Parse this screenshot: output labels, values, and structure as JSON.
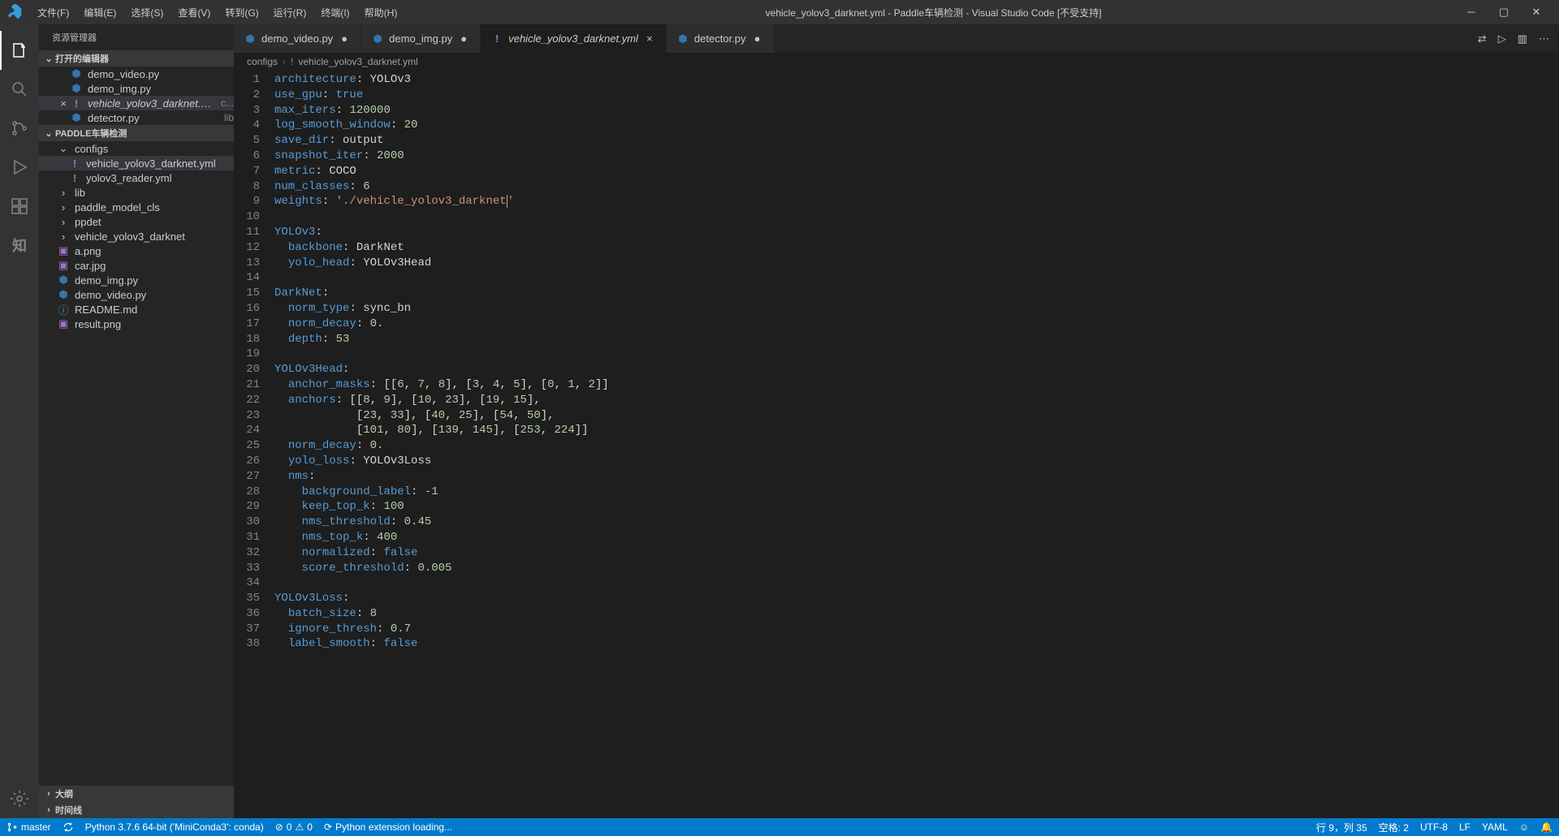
{
  "titlebar": {
    "title": "vehicle_yolov3_darknet.yml - Paddle车辆检测 - Visual Studio Code [不受支持]",
    "menu": [
      "文件(F)",
      "编辑(E)",
      "选择(S)",
      "查看(V)",
      "转到(G)",
      "运行(R)",
      "终端(I)",
      "帮助(H)"
    ]
  },
  "sidebar": {
    "title": "资源管理器",
    "sections": {
      "openEditors": "打开的编辑器",
      "project": "PADDLE车辆检测",
      "outline": "大纲",
      "timeline": "时间线"
    },
    "openEditors": [
      {
        "icon": "py",
        "label": "demo_video.py"
      },
      {
        "icon": "py",
        "label": "demo_img.py"
      },
      {
        "icon": "yml",
        "label": "vehicle_yolov3_darknet.yml",
        "hint": "c...",
        "active": true,
        "close": true,
        "italic": true
      },
      {
        "icon": "py",
        "label": "detector.py",
        "hint": "lib"
      }
    ],
    "tree": [
      {
        "type": "folder",
        "label": "configs",
        "open": true,
        "indent": 1
      },
      {
        "type": "file",
        "icon": "yml",
        "label": "vehicle_yolov3_darknet.yml",
        "indent": 2,
        "selected": true
      },
      {
        "type": "file",
        "icon": "yml",
        "label": "yolov3_reader.yml",
        "indent": 2
      },
      {
        "type": "folder",
        "label": "lib",
        "indent": 1
      },
      {
        "type": "folder",
        "label": "paddle_model_cls",
        "indent": 1
      },
      {
        "type": "folder",
        "label": "ppdet",
        "indent": 1
      },
      {
        "type": "folder",
        "label": "vehicle_yolov3_darknet",
        "indent": 1
      },
      {
        "type": "file",
        "icon": "img",
        "label": "a.png",
        "indent": 1
      },
      {
        "type": "file",
        "icon": "img",
        "label": "car.jpg",
        "indent": 1
      },
      {
        "type": "file",
        "icon": "py",
        "label": "demo_img.py",
        "indent": 1
      },
      {
        "type": "file",
        "icon": "py",
        "label": "demo_video.py",
        "indent": 1
      },
      {
        "type": "file",
        "icon": "md",
        "label": "README.md",
        "indent": 1
      },
      {
        "type": "file",
        "icon": "img",
        "label": "result.png",
        "indent": 1
      }
    ]
  },
  "tabs": [
    {
      "icon": "py",
      "label": "demo_video.py",
      "modified": true
    },
    {
      "icon": "py",
      "label": "demo_img.py",
      "modified": true
    },
    {
      "icon": "yml",
      "label": "vehicle_yolov3_darknet.yml",
      "active": true,
      "close": true,
      "italic": true,
      "modified": true
    },
    {
      "icon": "py",
      "label": "detector.py",
      "modified": true
    }
  ],
  "breadcrumb": {
    "parts": [
      "configs",
      "vehicle_yolov3_darknet.yml"
    ],
    "icon2": "yml"
  },
  "code_lines": [
    [
      {
        "t": "key",
        "v": "architecture"
      },
      {
        "t": "punc",
        "v": ":"
      },
      {
        "t": "plain",
        "v": " YOLOv3"
      }
    ],
    [
      {
        "t": "key",
        "v": "use_gpu"
      },
      {
        "t": "punc",
        "v": ":"
      },
      {
        "t": "plain",
        "v": " "
      },
      {
        "t": "bool",
        "v": "true"
      }
    ],
    [
      {
        "t": "key",
        "v": "max_iters"
      },
      {
        "t": "punc",
        "v": ":"
      },
      {
        "t": "plain",
        "v": " "
      },
      {
        "t": "num",
        "v": "120000"
      }
    ],
    [
      {
        "t": "key",
        "v": "log_smooth_window"
      },
      {
        "t": "punc",
        "v": ":"
      },
      {
        "t": "plain",
        "v": " "
      },
      {
        "t": "num",
        "v": "20"
      }
    ],
    [
      {
        "t": "key",
        "v": "save_dir"
      },
      {
        "t": "punc",
        "v": ":"
      },
      {
        "t": "plain",
        "v": " output"
      }
    ],
    [
      {
        "t": "key",
        "v": "snapshot_iter"
      },
      {
        "t": "punc",
        "v": ":"
      },
      {
        "t": "plain",
        "v": " "
      },
      {
        "t": "num",
        "v": "2000"
      }
    ],
    [
      {
        "t": "key",
        "v": "metric"
      },
      {
        "t": "punc",
        "v": ":"
      },
      {
        "t": "plain",
        "v": " COCO"
      }
    ],
    [
      {
        "t": "key",
        "v": "num_classes"
      },
      {
        "t": "punc",
        "v": ":"
      },
      {
        "t": "plain",
        "v": " "
      },
      {
        "t": "num",
        "v": "6"
      }
    ],
    [
      {
        "t": "key",
        "v": "weights"
      },
      {
        "t": "punc",
        "v": ":"
      },
      {
        "t": "plain",
        "v": " "
      },
      {
        "t": "str",
        "v": "'./vehicle_yolov3_darknet"
      },
      {
        "t": "cursor",
        "v": ""
      },
      {
        "t": "str",
        "v": "'"
      }
    ],
    [],
    [
      {
        "t": "key",
        "v": "YOLOv3"
      },
      {
        "t": "punc",
        "v": ":"
      }
    ],
    [
      {
        "t": "plain",
        "v": "  "
      },
      {
        "t": "key",
        "v": "backbone"
      },
      {
        "t": "punc",
        "v": ":"
      },
      {
        "t": "plain",
        "v": " DarkNet"
      }
    ],
    [
      {
        "t": "plain",
        "v": "  "
      },
      {
        "t": "key",
        "v": "yolo_head"
      },
      {
        "t": "punc",
        "v": ":"
      },
      {
        "t": "plain",
        "v": " YOLOv3Head"
      }
    ],
    [],
    [
      {
        "t": "key",
        "v": "DarkNet"
      },
      {
        "t": "punc",
        "v": ":"
      }
    ],
    [
      {
        "t": "plain",
        "v": "  "
      },
      {
        "t": "key",
        "v": "norm_type"
      },
      {
        "t": "punc",
        "v": ":"
      },
      {
        "t": "plain",
        "v": " sync_bn"
      }
    ],
    [
      {
        "t": "plain",
        "v": "  "
      },
      {
        "t": "key",
        "v": "norm_decay"
      },
      {
        "t": "punc",
        "v": ":"
      },
      {
        "t": "plain",
        "v": " "
      },
      {
        "t": "num",
        "v": "0."
      }
    ],
    [
      {
        "t": "plain",
        "v": "  "
      },
      {
        "t": "key",
        "v": "depth"
      },
      {
        "t": "punc",
        "v": ":"
      },
      {
        "t": "plain",
        "v": " "
      },
      {
        "t": "num",
        "v": "53"
      }
    ],
    [],
    [
      {
        "t": "key",
        "v": "YOLOv3Head"
      },
      {
        "t": "punc",
        "v": ":"
      }
    ],
    [
      {
        "t": "plain",
        "v": "  "
      },
      {
        "t": "key",
        "v": "anchor_masks"
      },
      {
        "t": "punc",
        "v": ":"
      },
      {
        "t": "plain",
        "v": " [["
      },
      {
        "t": "num",
        "v": "6"
      },
      {
        "t": "plain",
        "v": ", "
      },
      {
        "t": "num",
        "v": "7"
      },
      {
        "t": "plain",
        "v": ", "
      },
      {
        "t": "num",
        "v": "8"
      },
      {
        "t": "plain",
        "v": "], ["
      },
      {
        "t": "num",
        "v": "3"
      },
      {
        "t": "plain",
        "v": ", "
      },
      {
        "t": "num",
        "v": "4"
      },
      {
        "t": "plain",
        "v": ", "
      },
      {
        "t": "num",
        "v": "5"
      },
      {
        "t": "plain",
        "v": "], ["
      },
      {
        "t": "num",
        "v": "0"
      },
      {
        "t": "plain",
        "v": ", "
      },
      {
        "t": "num",
        "v": "1"
      },
      {
        "t": "plain",
        "v": ", "
      },
      {
        "t": "num",
        "v": "2"
      },
      {
        "t": "plain",
        "v": "]]"
      }
    ],
    [
      {
        "t": "plain",
        "v": "  "
      },
      {
        "t": "key",
        "v": "anchors"
      },
      {
        "t": "punc",
        "v": ":"
      },
      {
        "t": "plain",
        "v": " [["
      },
      {
        "t": "num",
        "v": "8"
      },
      {
        "t": "plain",
        "v": ", "
      },
      {
        "t": "num",
        "v": "9"
      },
      {
        "t": "plain",
        "v": "], ["
      },
      {
        "t": "num",
        "v": "10"
      },
      {
        "t": "plain",
        "v": ", "
      },
      {
        "t": "num",
        "v": "23"
      },
      {
        "t": "plain",
        "v": "], ["
      },
      {
        "t": "num",
        "v": "19"
      },
      {
        "t": "plain",
        "v": ", "
      },
      {
        "t": "num",
        "v": "15"
      },
      {
        "t": "plain",
        "v": "],"
      }
    ],
    [
      {
        "t": "plain",
        "v": "            ["
      },
      {
        "t": "num",
        "v": "23"
      },
      {
        "t": "plain",
        "v": ", "
      },
      {
        "t": "num",
        "v": "33"
      },
      {
        "t": "plain",
        "v": "], ["
      },
      {
        "t": "num",
        "v": "40"
      },
      {
        "t": "plain",
        "v": ", "
      },
      {
        "t": "num",
        "v": "25"
      },
      {
        "t": "plain",
        "v": "], ["
      },
      {
        "t": "num",
        "v": "54"
      },
      {
        "t": "plain",
        "v": ", "
      },
      {
        "t": "num",
        "v": "50"
      },
      {
        "t": "plain",
        "v": "],"
      }
    ],
    [
      {
        "t": "plain",
        "v": "            ["
      },
      {
        "t": "num",
        "v": "101"
      },
      {
        "t": "plain",
        "v": ", "
      },
      {
        "t": "num",
        "v": "80"
      },
      {
        "t": "plain",
        "v": "], ["
      },
      {
        "t": "num",
        "v": "139"
      },
      {
        "t": "plain",
        "v": ", "
      },
      {
        "t": "num",
        "v": "145"
      },
      {
        "t": "plain",
        "v": "], ["
      },
      {
        "t": "num",
        "v": "253"
      },
      {
        "t": "plain",
        "v": ", "
      },
      {
        "t": "num",
        "v": "224"
      },
      {
        "t": "plain",
        "v": "]]"
      }
    ],
    [
      {
        "t": "plain",
        "v": "  "
      },
      {
        "t": "key",
        "v": "norm_decay"
      },
      {
        "t": "punc",
        "v": ":"
      },
      {
        "t": "plain",
        "v": " "
      },
      {
        "t": "num",
        "v": "0."
      }
    ],
    [
      {
        "t": "plain",
        "v": "  "
      },
      {
        "t": "key",
        "v": "yolo_loss"
      },
      {
        "t": "punc",
        "v": ":"
      },
      {
        "t": "plain",
        "v": " YOLOv3Loss"
      }
    ],
    [
      {
        "t": "plain",
        "v": "  "
      },
      {
        "t": "key",
        "v": "nms"
      },
      {
        "t": "punc",
        "v": ":"
      }
    ],
    [
      {
        "t": "plain",
        "v": "    "
      },
      {
        "t": "key",
        "v": "background_label"
      },
      {
        "t": "punc",
        "v": ":"
      },
      {
        "t": "plain",
        "v": " "
      },
      {
        "t": "num",
        "v": "-1"
      }
    ],
    [
      {
        "t": "plain",
        "v": "    "
      },
      {
        "t": "key",
        "v": "keep_top_k"
      },
      {
        "t": "punc",
        "v": ":"
      },
      {
        "t": "plain",
        "v": " "
      },
      {
        "t": "num",
        "v": "100"
      }
    ],
    [
      {
        "t": "plain",
        "v": "    "
      },
      {
        "t": "key",
        "v": "nms_threshold"
      },
      {
        "t": "punc",
        "v": ":"
      },
      {
        "t": "plain",
        "v": " "
      },
      {
        "t": "num",
        "v": "0.45"
      }
    ],
    [
      {
        "t": "plain",
        "v": "    "
      },
      {
        "t": "key",
        "v": "nms_top_k"
      },
      {
        "t": "punc",
        "v": ":"
      },
      {
        "t": "plain",
        "v": " "
      },
      {
        "t": "num",
        "v": "400"
      }
    ],
    [
      {
        "t": "plain",
        "v": "    "
      },
      {
        "t": "key",
        "v": "normalized"
      },
      {
        "t": "punc",
        "v": ":"
      },
      {
        "t": "plain",
        "v": " "
      },
      {
        "t": "bool",
        "v": "false"
      }
    ],
    [
      {
        "t": "plain",
        "v": "    "
      },
      {
        "t": "key",
        "v": "score_threshold"
      },
      {
        "t": "punc",
        "v": ":"
      },
      {
        "t": "plain",
        "v": " "
      },
      {
        "t": "num",
        "v": "0.005"
      }
    ],
    [],
    [
      {
        "t": "key",
        "v": "YOLOv3Loss"
      },
      {
        "t": "punc",
        "v": ":"
      }
    ],
    [
      {
        "t": "plain",
        "v": "  "
      },
      {
        "t": "key",
        "v": "batch_size"
      },
      {
        "t": "punc",
        "v": ":"
      },
      {
        "t": "plain",
        "v": " "
      },
      {
        "t": "num",
        "v": "8"
      }
    ],
    [
      {
        "t": "plain",
        "v": "  "
      },
      {
        "t": "key",
        "v": "ignore_thresh"
      },
      {
        "t": "punc",
        "v": ":"
      },
      {
        "t": "plain",
        "v": " "
      },
      {
        "t": "num",
        "v": "0.7"
      }
    ],
    [
      {
        "t": "plain",
        "v": "  "
      },
      {
        "t": "key",
        "v": "label_smooth"
      },
      {
        "t": "punc",
        "v": ":"
      },
      {
        "t": "plain",
        "v": " "
      },
      {
        "t": "bool",
        "v": "false"
      }
    ]
  ],
  "statusbar": {
    "branch": "master",
    "python": "Python 3.7.6 64-bit ('MiniConda3': conda)",
    "problems_err": "0",
    "problems_warn": "0",
    "loading": "Python extension loading...",
    "lncol": "行 9，列 35",
    "spaces": "空格: 2",
    "encoding": "UTF-8",
    "eol": "LF",
    "lang": "YAML",
    "feedback_icon": "☺",
    "bell_icon": "🔔"
  }
}
